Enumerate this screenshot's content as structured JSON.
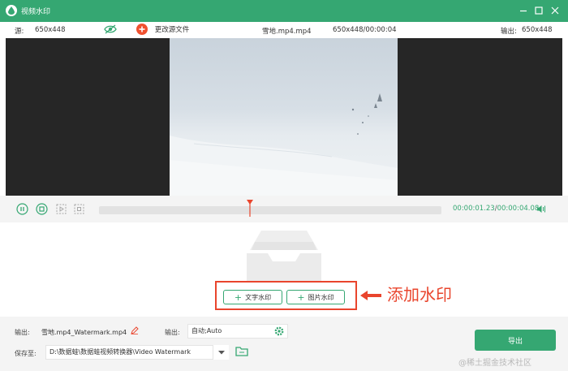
{
  "window": {
    "title": "视频水印",
    "controls": [
      "minimize-icon",
      "maximize-icon",
      "close-icon"
    ]
  },
  "info_bar": {
    "source_label": "源:",
    "source_resolution": "650x448",
    "change_source_label": "更改源文件",
    "file_name": "雪地.mp4.mp4",
    "file_details": "650x448/00:00:04",
    "output_label": "输出:",
    "output_resolution": "650x448"
  },
  "playback": {
    "current_time": "00:00:01.23",
    "separator": "/",
    "total_time": "00:00:04.08",
    "progress": 0.44
  },
  "watermark": {
    "add_text_label": "文字水印",
    "add_image_label": "图片水印",
    "callout": "添加水印"
  },
  "bottom": {
    "output_label": "输出:",
    "output_name": "雪地.mp4_Watermark.mp4",
    "format_label": "输出:",
    "format_value": "自动;Auto",
    "save_label": "保存至:",
    "save_path": "D:\\数据蛙\\数据蛙视频转换器\\Video Watermark",
    "export_label": "导出"
  },
  "site_watermark": "@稀土掘金技术社区",
  "colors": {
    "accent": "#35a772",
    "highlight": "#e9452d",
    "change_source_icon": "#f0512f"
  }
}
